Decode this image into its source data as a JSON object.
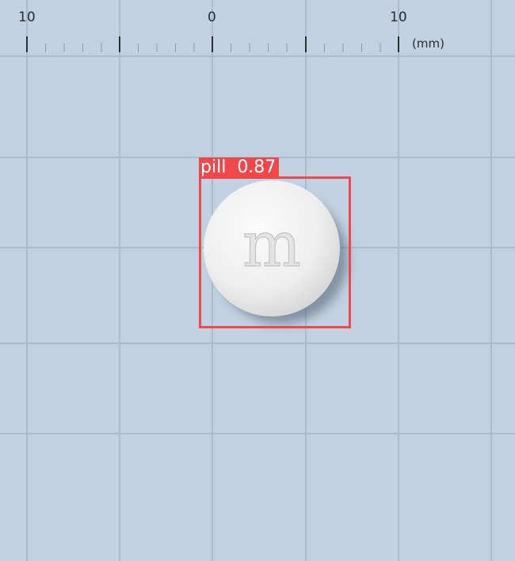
{
  "ruler": {
    "ticks": [
      "10",
      "0",
      "10"
    ],
    "unit": "(mm)"
  },
  "pill": {
    "imprint": "m",
    "color": "#f1f1f1"
  },
  "detection": {
    "class_label": "pill",
    "confidence": "0.87",
    "box_color": "#f0474a"
  }
}
